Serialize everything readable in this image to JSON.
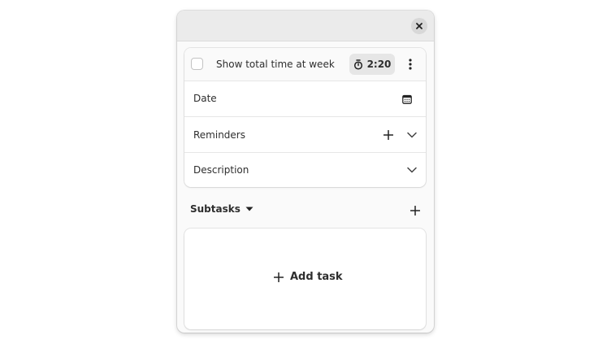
{
  "window": {
    "close_icon": "close-icon"
  },
  "task": {
    "title": "Show total time at week",
    "completed": false,
    "timer_icon": "stopwatch-icon",
    "timer_value": "2:20",
    "menu_icon": "vertical-ellipsis-icon"
  },
  "details": {
    "date_label": "Date",
    "date_icon": "calendar-icon",
    "reminders_label": "Reminders",
    "reminders_add_icon": "plus-icon",
    "reminders_expand_icon": "chevron-down-icon",
    "description_label": "Description",
    "description_expand_icon": "chevron-down-icon"
  },
  "subtasks": {
    "label": "Subtasks",
    "dropdown_icon": "caret-down-icon",
    "add_icon": "plus-icon",
    "add_task_label": "Add task"
  }
}
